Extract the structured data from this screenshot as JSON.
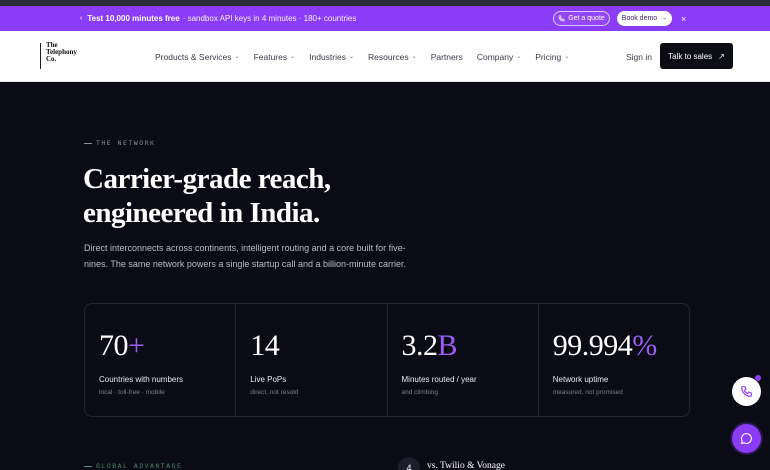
{
  "promo": {
    "caret": "‹",
    "bold": "Test 10,000 minutes free",
    "rest": "· sandbox API keys in 4 minutes · 180+ countries",
    "quote_label": "Get a quote",
    "demo_label": "Book demo",
    "close": "×"
  },
  "nav": {
    "logo_name": "The Telephony Co.",
    "logo_line1": "The",
    "logo_line2": "Telephony",
    "logo_line3": "Co.",
    "links": [
      {
        "label": "Products & Services"
      },
      {
        "label": "Features"
      },
      {
        "label": "Industries"
      },
      {
        "label": "Resources"
      },
      {
        "label": "Partners"
      },
      {
        "label": "Company"
      },
      {
        "label": "Pricing"
      }
    ],
    "signin": "Sign in",
    "cta": "Talk to sales"
  },
  "hero": {
    "eyebrow": "THE NETWORK",
    "headline_1": "Carrier-grade reach,",
    "headline_2": "engineered in India.",
    "lede": "Direct interconnects across continents, intelligent routing and a core built for five-nines. The same network powers a single startup call and a billion-minute carrier."
  },
  "stats": [
    {
      "value": "70",
      "suffix": "+",
      "label": "Countries with numbers",
      "sub": "local · toll-free · mobile"
    },
    {
      "value": "14",
      "suffix": "",
      "label": "Live PoPs",
      "sub": "direct, not resold"
    },
    {
      "value": "3.2",
      "suffix": "B",
      "label": "Minutes routed / year",
      "sub": "and climbing"
    },
    {
      "value": "99.994",
      "suffix": "%",
      "label": "Network uptime",
      "sub": "measured, not promised"
    }
  ],
  "next": {
    "eyebrow": "GLOBAL ADVANTAGE",
    "badge": "4",
    "title": "vs. Twilio & Vonage"
  },
  "colors": {
    "accent": "#8b3cf6",
    "background": "#0b0b16"
  }
}
